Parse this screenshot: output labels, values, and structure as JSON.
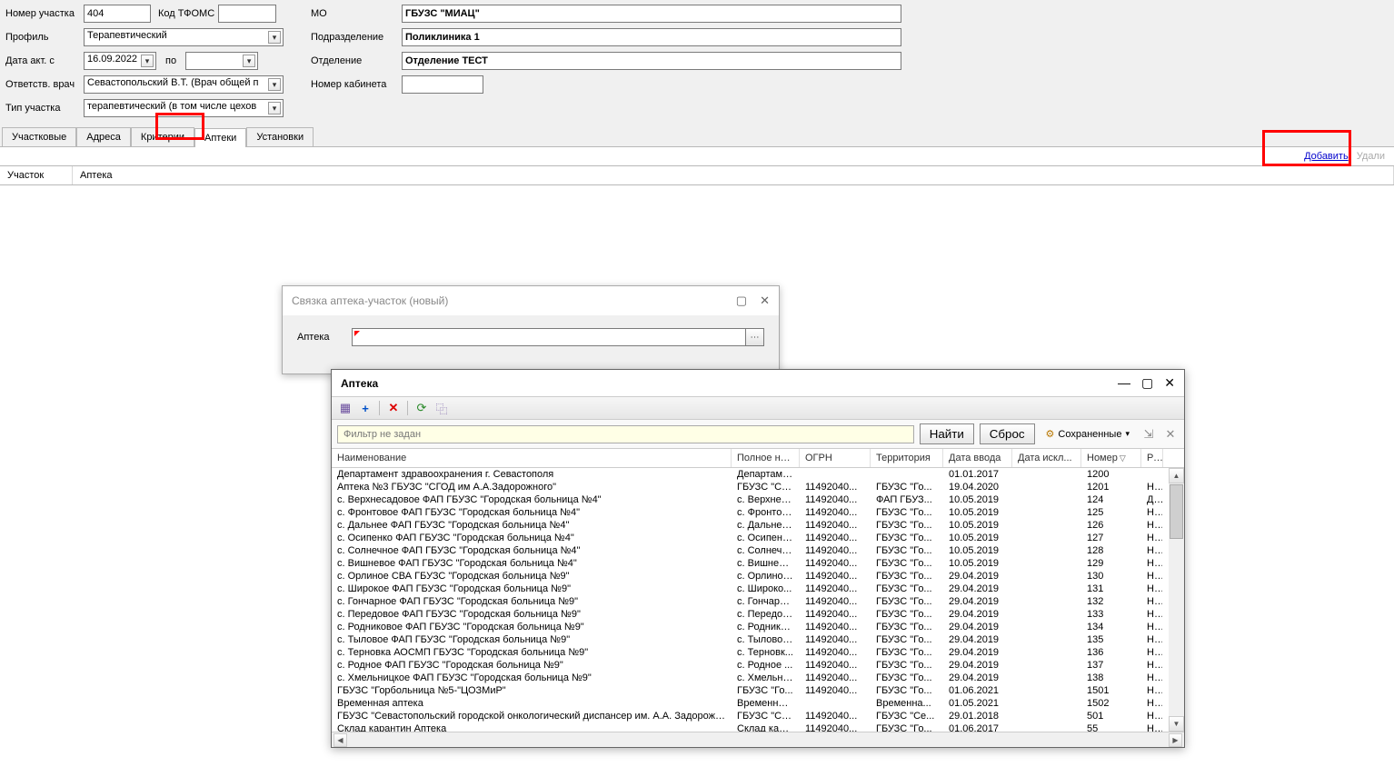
{
  "form": {
    "labels": {
      "section_number": "Номер участка",
      "tfoms_code": "Код ТФОМС",
      "profile": "Профиль",
      "date_act_from": "Дата акт. с",
      "date_to": "по",
      "resp_doctor": "Ответств. врач",
      "section_type": "Тип участка",
      "mo": "МО",
      "subdivision": "Подразделение",
      "department": "Отделение",
      "room": "Номер кабинета"
    },
    "values": {
      "section_number": "404",
      "tfoms_code": "",
      "profile": "Терапевтический",
      "date_from": "16.09.2022",
      "date_to": "",
      "resp_doctor": "Севастопольский В.Т. (Врач общей п",
      "section_type": "терапевтический (в том числе цехов",
      "mo": "ГБУЗС \"МИАЦ\"",
      "subdivision": "Поликлиника 1",
      "department": "Отделение ТЕСТ",
      "room": ""
    }
  },
  "tabs": [
    "Участковые",
    "Адреса",
    "Критерии",
    "Аптеки",
    "Установки"
  ],
  "active_tab_index": 3,
  "actions": {
    "add": "Добавить",
    "delete": "Удали"
  },
  "main_table": {
    "headers": [
      "Участок",
      "Аптека"
    ]
  },
  "dialog1": {
    "title": "Связка аптека-участок (новый)",
    "label": "Аптека"
  },
  "dialog2": {
    "title": "Аптека",
    "filter_placeholder": "Фильтр не задан",
    "btn_find": "Найти",
    "btn_reset": "Сброс",
    "saved_label": "Сохраненные",
    "columns": {
      "name": "Наименование",
      "fullname": "Полное наи...",
      "ogrn": "ОГРН",
      "territory": "Территория",
      "date_in": "Дата ввода",
      "date_out": "Дата искл...",
      "number": "Номер",
      "ra": "Ра"
    },
    "rows": [
      {
        "name": "Департамент здравоохранения г. Севастополя",
        "full": "Департаме...",
        "ogrn": "",
        "terr": "",
        "din": "01.01.2017",
        "dout": "",
        "num": "1200",
        "ra": ""
      },
      {
        "name": "Аптека №3 ГБУЗС \"СГОД им А.А.Задорожного\"",
        "full": "ГБУЗС \"СГ...",
        "ogrn": "11492040...",
        "terr": "ГБУЗС \"Го...",
        "din": "19.04.2020",
        "dout": "",
        "num": "1201",
        "ra": "Не"
      },
      {
        "name": "с. Верхнесадовое ФАП ГБУЗС \"Городская больница №4\"",
        "full": "с. Верхнес...",
        "ogrn": "11492040...",
        "terr": "ФАП ГБУЗ...",
        "din": "10.05.2019",
        "dout": "",
        "num": "124",
        "ra": "Да"
      },
      {
        "name": "с. Фронтовое ФАП ГБУЗС \"Городская больница №4\"",
        "full": "с. Фронтов...",
        "ogrn": "11492040...",
        "terr": "ГБУЗС \"Го...",
        "din": "10.05.2019",
        "dout": "",
        "num": "125",
        "ra": "Не"
      },
      {
        "name": "с. Дальнее ФАП ГБУЗС \"Городская больница №4\"",
        "full": "с. Дальнее...",
        "ogrn": "11492040...",
        "terr": "ГБУЗС \"Го...",
        "din": "10.05.2019",
        "dout": "",
        "num": "126",
        "ra": "Не"
      },
      {
        "name": "с. Осипенко ФАП ГБУЗС \"Городская больница №4\"",
        "full": "с. Осипенк...",
        "ogrn": "11492040...",
        "terr": "ГБУЗС \"Го...",
        "din": "10.05.2019",
        "dout": "",
        "num": "127",
        "ra": "Не"
      },
      {
        "name": "с. Солнечное ФАП ГБУЗС \"Городская больница №4\"",
        "full": "с. Солнечн...",
        "ogrn": "11492040...",
        "terr": "ГБУЗС \"Го...",
        "din": "10.05.2019",
        "dout": "",
        "num": "128",
        "ra": "Не"
      },
      {
        "name": "с. Вишневое ФАП ГБУЗС \"Городская больница №4\"",
        "full": "с. Вишнево...",
        "ogrn": "11492040...",
        "terr": "ГБУЗС \"Го...",
        "din": "10.05.2019",
        "dout": "",
        "num": "129",
        "ra": "Не"
      },
      {
        "name": "с. Орлиное СВА ГБУЗС \"Городская больница №9\"",
        "full": "с. Орлиное ...",
        "ogrn": "11492040...",
        "terr": "ГБУЗС \"Го...",
        "din": "29.04.2019",
        "dout": "",
        "num": "130",
        "ra": "Не"
      },
      {
        "name": "с. Широкое ФАП ГБУЗС \"Городская больница №9\"",
        "full": "с. Широко...",
        "ogrn": "11492040...",
        "terr": "ГБУЗС \"Го...",
        "din": "29.04.2019",
        "dout": "",
        "num": "131",
        "ra": "Не"
      },
      {
        "name": "с. Гончарное ФАП ГБУЗС \"Городская больница №9\"",
        "full": "с. Гончарно...",
        "ogrn": "11492040...",
        "terr": "ГБУЗС \"Го...",
        "din": "29.04.2019",
        "dout": "",
        "num": "132",
        "ra": "Не"
      },
      {
        "name": "с. Передовое ФАП ГБУЗС \"Городская больница №9\"",
        "full": "с. Передов...",
        "ogrn": "11492040...",
        "terr": "ГБУЗС \"Го...",
        "din": "29.04.2019",
        "dout": "",
        "num": "133",
        "ra": "Не"
      },
      {
        "name": "с. Родниковое ФАП ГБУЗС \"Городская больница №9\"",
        "full": "с. Роднико...",
        "ogrn": "11492040...",
        "terr": "ГБУЗС \"Го...",
        "din": "29.04.2019",
        "dout": "",
        "num": "134",
        "ra": "Не"
      },
      {
        "name": "с. Тыловое ФАП ГБУЗС \"Городская больница №9\"",
        "full": "с. Тыловое...",
        "ogrn": "11492040...",
        "terr": "ГБУЗС \"Го...",
        "din": "29.04.2019",
        "dout": "",
        "num": "135",
        "ra": "Не"
      },
      {
        "name": "с. Терновка АОСМП ГБУЗС \"Городская больница №9\"",
        "full": "с. Терновк...",
        "ogrn": "11492040...",
        "terr": "ГБУЗС \"Го...",
        "din": "29.04.2019",
        "dout": "",
        "num": "136",
        "ra": "Не"
      },
      {
        "name": "с. Родное ФАП ГБУЗС \"Городская больница №9\"",
        "full": "с. Родное ...",
        "ogrn": "11492040...",
        "terr": "ГБУЗС \"Го...",
        "din": "29.04.2019",
        "dout": "",
        "num": "137",
        "ra": "Не"
      },
      {
        "name": "с. Хмельницкое ФАП ГБУЗС \"Городская больница №9\"",
        "full": "с. Хмельни...",
        "ogrn": "11492040...",
        "terr": "ГБУЗС \"Го...",
        "din": "29.04.2019",
        "dout": "",
        "num": "138",
        "ra": "Не"
      },
      {
        "name": "ГБУЗС \"Горбольница №5-\"ЦОЗМиР\"",
        "full": "ГБУЗС \"Го...",
        "ogrn": "11492040...",
        "terr": "ГБУЗС \"Го...",
        "din": "01.06.2021",
        "dout": "",
        "num": "1501",
        "ra": "Не"
      },
      {
        "name": "Временная аптека",
        "full": "Временная...",
        "ogrn": "",
        "terr": "Временна...",
        "din": "01.05.2021",
        "dout": "",
        "num": "1502",
        "ra": "Не"
      },
      {
        "name": "ГБУЗС \"Севастопольский городской онкологический диспансер им. А.А. Задорожного\"",
        "full": "ГБУЗС \"Се...",
        "ogrn": "11492040...",
        "terr": "ГБУЗС \"Се...",
        "din": "29.01.2018",
        "dout": "",
        "num": "501",
        "ra": "Не"
      },
      {
        "name": "Склад карантин Аптека",
        "full": "Склад кара...",
        "ogrn": "11492040...",
        "terr": "ГБУЗС \"Го...",
        "din": "01.06.2017",
        "dout": "",
        "num": "55",
        "ra": "Не"
      }
    ]
  }
}
